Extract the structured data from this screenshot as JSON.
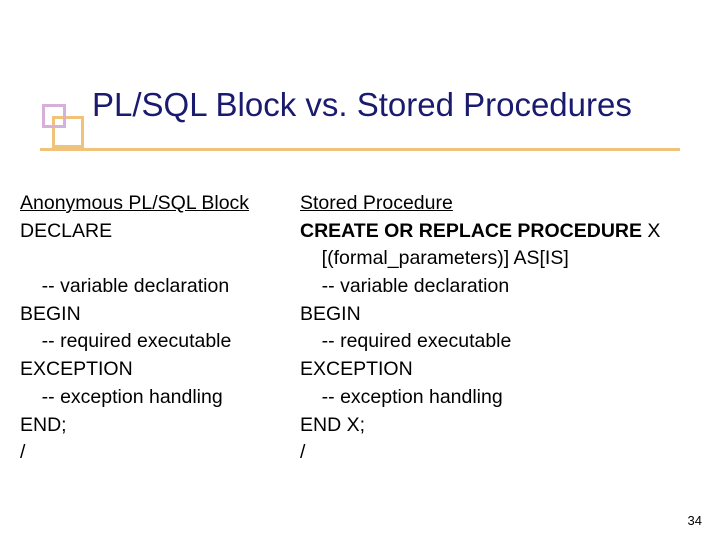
{
  "title": "PL/SQL Block vs. Stored Procedures",
  "left": {
    "heading": "Anonymous PL/SQL Block",
    "l1": "DECLARE",
    "l2": " ",
    "l3": "    -- variable declaration",
    "l4": "BEGIN",
    "l5": "    -- required executable",
    "l6": "EXCEPTION",
    "l7": "    -- exception handling",
    "l8": "END;",
    "l9": "/"
  },
  "right": {
    "heading": "Stored Procedure",
    "l1a": "CREATE OR REPLACE PROCEDURE",
    "l1b": " X",
    "l2": "    [(formal_parameters)] AS[IS]",
    "l3": "    -- variable declaration",
    "l4": "BEGIN",
    "l5": "    -- required executable",
    "l6": "EXCEPTION",
    "l7": "    -- exception handling",
    "l8": "END X;",
    "l9": "/"
  },
  "slide_number": "34"
}
